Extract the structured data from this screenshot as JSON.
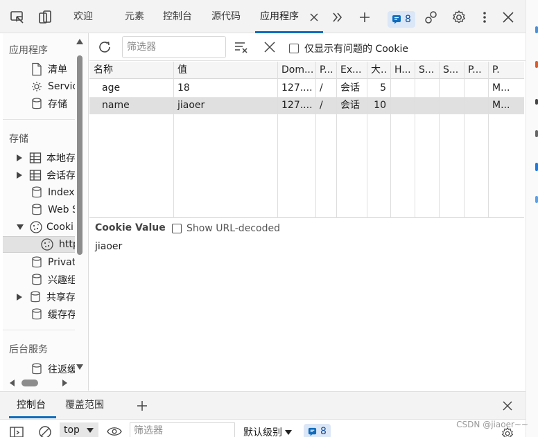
{
  "toolbar": {
    "tabs": [
      {
        "label": "欢迎"
      },
      {
        "label": "元素"
      },
      {
        "label": "控制台"
      },
      {
        "label": "源代码"
      },
      {
        "label": "应用程序"
      }
    ],
    "issues_count": "8"
  },
  "sidebar": {
    "app_section": "应用程序",
    "app_items": [
      {
        "label": "清单",
        "icon": "file-icon"
      },
      {
        "label": "Servic",
        "icon": "gear-icon"
      },
      {
        "label": "存储",
        "icon": "database-icon"
      }
    ],
    "storage_section": "存储",
    "storage_items": [
      {
        "label": "本地存",
        "icon": "table-icon"
      },
      {
        "label": "会话存",
        "icon": "table-icon"
      },
      {
        "label": "Index",
        "icon": "database-icon"
      },
      {
        "label": "Web S",
        "icon": "database-icon"
      },
      {
        "label": "Cooki",
        "icon": "cookie-icon"
      },
      {
        "label": "http",
        "icon": "cookie-icon"
      },
      {
        "label": "Privat",
        "icon": "database-icon"
      },
      {
        "label": "兴趣组",
        "icon": "database-icon"
      },
      {
        "label": "共享存",
        "icon": "database-icon"
      },
      {
        "label": "缓存存",
        "icon": "database-icon"
      }
    ],
    "background_section": "后台服务",
    "background_items": [
      {
        "label": "往返缓",
        "icon": "database-icon"
      }
    ]
  },
  "filter": {
    "placeholder": "筛选器",
    "only_issues_label": "仅显示有问题的 Cookie"
  },
  "table": {
    "headers": [
      "名称",
      "值",
      "Dom...",
      "P...",
      "Ex...",
      "大..",
      "H...",
      "S...",
      "S...",
      "P...",
      "P."
    ],
    "rows": [
      {
        "cells": [
          "age",
          "18",
          "127....",
          "/",
          "会话",
          "5",
          "",
          "",
          "",
          "",
          "M..."
        ]
      },
      {
        "cells": [
          "name",
          "jiaoer",
          "127....",
          "/",
          "会话",
          "10",
          "",
          "",
          "",
          "",
          "M..."
        ],
        "selected": true
      }
    ]
  },
  "cookie_value": {
    "title": "Cookie Value",
    "decode_label": "Show URL-decoded",
    "value": "jiaoer"
  },
  "drawer": {
    "tabs": [
      {
        "label": "控制台"
      },
      {
        "label": "覆盖范围"
      }
    ],
    "context": "top",
    "filter_placeholder": "筛选器",
    "level_label": "默认级别",
    "issues_count": "8"
  },
  "watermark": "CSDN @jiaoer~~",
  "colors": {
    "accent": "#0f6cbd",
    "selected_row": "#e0e0e0"
  }
}
